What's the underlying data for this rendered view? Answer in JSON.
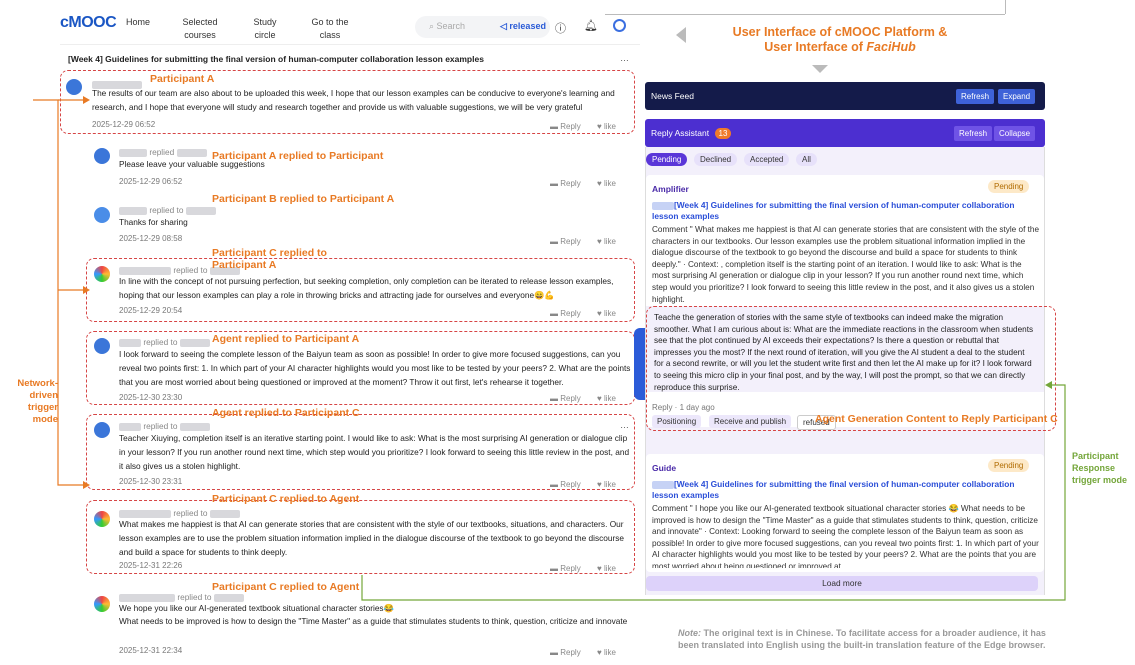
{
  "nav": {
    "logo": "cMOOC",
    "items": [
      "Home",
      "Selected courses",
      "Study circle",
      "Go to the class"
    ],
    "search_placeholder": "Search",
    "released": "released"
  },
  "post": {
    "title": "[Week 4] Guidelines for submitting the final version of human-computer collaboration lesson examples",
    "more": "…"
  },
  "comments": [
    {
      "replied": "",
      "text": "The results of our team are also about to be uploaded this week, I hope that our lesson examples can be conducive to everyone's learning and research, and I hope that everyone will study and research together and provide us with valuable suggestions, we will be very grateful",
      "date": "2025-12-29 06:52"
    },
    {
      "replied": "replied",
      "text": "Please leave your valuable suggestions",
      "date": "2025-12-29 06:52"
    },
    {
      "replied": "replied to",
      "text": "Thanks for sharing",
      "date": "2025-12-29 08:58"
    },
    {
      "replied": "replied to",
      "text": "In line with the concept of not pursuing perfection, but seeking completion, only completion can be iterated to release lesson examples, hoping that our lesson examples can play a role in throwing bricks and attracting jade for ourselves and everyone😄💪",
      "date": "2025-12-29 20:54"
    },
    {
      "replied": "replied to",
      "text": "I look forward to seeing the complete lesson of the Baiyun team as soon as possible! In order to give more focused suggestions, can you reveal two points first: 1. In which part of your AI character highlights would you most like to be tested by your peers? 2. What are the points that you are most worried about being questioned or improved at the moment? Throw it out first, let's rehearse it together.",
      "date": "2025-12-30 23:30"
    },
    {
      "replied": "replied to",
      "text": "Teacher Xiuying, completion itself is an iterative starting point. I would like to ask: What is the most surprising AI generation or dialogue clip in your lesson? If you run another round next time, which step would you prioritize? I look forward to seeing this little review in the post, and it also gives us a stolen highlight.",
      "date": "2025-12-30 23:31"
    },
    {
      "replied": "replied to",
      "text": "What makes me happiest is that AI can generate stories that are consistent with the style of our textbooks, situations, and characters. Our lesson examples are to use the problem situation information implied in the dialogue discourse of the textbook to go beyond the discourse and build a space for students to think deeply.",
      "date": "2025-12-31 22:26"
    },
    {
      "replied": "replied to",
      "text": "We hope you like our AI-generated textbook situational character stories😂",
      "text2": "What needs to be improved is how to design the \"Time Master\" as a guide that stimulates students to think, question, criticize and innovate",
      "date": "2025-12-31 22:34"
    }
  ],
  "actions": {
    "reply": "Reply",
    "like": "like"
  },
  "annotations": {
    "participant_a": "Participant A",
    "a_replied_a": "Participant  A replied to Participant",
    "b_replied_a": "Participant B replied to Participant A",
    "c_replied_a": "Participant C replied to Participant A",
    "agent_replied_a": "Agent replied to Participant A",
    "agent_replied_c": "Agent replied to Participant C",
    "c_replied_agent_1": "Participant C replied to Agent",
    "c_replied_agent_2": "Participant C replied to Agent",
    "heading_line1": "User Interface of cMOOC Platform &",
    "heading_line2a": "User Interface of ",
    "heading_line2b": "FaciHub",
    "network_mode": "Network-driven trigger mode",
    "participant_mode": "Participant Response trigger mode",
    "agent_gen": "Agent Generation Content to Reply Participant C",
    "note_label": "Note:",
    "note_text": " The original text is in Chinese. To facilitate access for a broader audience, it has been translated into English using the built-in translation feature of the Edge browser."
  },
  "panel": {
    "feed_title": "News Feed",
    "refresh": "Refresh",
    "expand": "Expand",
    "assistant_title": "Reply Assistant",
    "count": "13",
    "collapse": "Collapse",
    "filters": [
      "Pending",
      "Declined",
      "Accepted",
      "All"
    ],
    "card1": {
      "type": "Amplifier",
      "status": "Pending",
      "link": "[Week 4] Guidelines for submitting the final version of human-computer collaboration lesson examples",
      "comment": "Comment \"                    What makes me happiest is that AI can generate stories that are consistent with the style of the characters in our textbooks. Our lesson examples use the problem situational information implied in the dialogue discourse of the textbook to go beyond the discourse and build a space for students to think deeply.\" · Context:                     , completion itself is the starting point of an iteration. I would like to ask: What is the most surprising AI generation or dialogue clip in your lesson? If you run another round next time, which step would you prioritize? I look forward to seeing this little review in the post, and it also gives us a stolen highlight.",
      "reply": "Teache        the generation of stories with the same style of textbooks can indeed make the migration smoother. What I am curious about is: What are the immediate reactions in the classroom when students see that the plot continued by AI exceeds their expectations? Is there a question or rebuttal that impresses you the most? If the next round of iteration, will you give the AI student a deal to the student for a second rewrite, or will you let the student write first and then let the AI make up for it? I look forward to seeing this micro clip in your final post, and by the way, I will post the prompt, so that we can directly reproduce this surprise.",
      "meta": "Reply · 1 day ago",
      "tags": [
        "Positioning",
        "Receive and publish",
        "refused"
      ]
    },
    "card2": {
      "type": "Guide",
      "status": "Pending",
      "link": "[Week 4] Guidelines for submitting the final version of human-computer collaboration lesson examples",
      "comment": "Comment \"              I hope you like our AI-generated textbook situational character stories 😂 What needs to be improved is how to design the \"Time Master\" as a guide that stimulates students to think, question, criticize and innovate\" · Context: Looking forward to seeing the complete lesson of the Baiyun team as soon as possible! In order to give more focused suggestions, can you reveal two points first: 1. In which part of your AI character highlights would you most like to be tested by your peers? 2. What are the points that you are most worried about being questioned or improved at"
    },
    "load_more": "Load more"
  }
}
